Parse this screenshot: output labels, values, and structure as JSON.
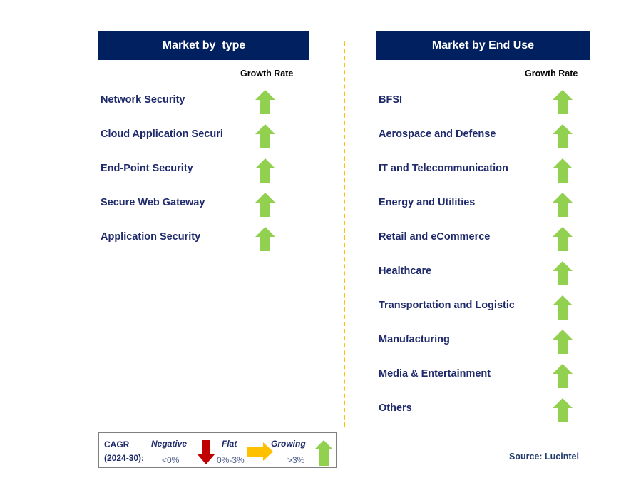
{
  "left_panel": {
    "title": "Market by  type",
    "growth_label": "Growth Rate",
    "items": [
      {
        "label": "Network Security",
        "trend": "growing"
      },
      {
        "label": "Cloud Application Securi",
        "trend": "growing"
      },
      {
        "label": "End-Point Security",
        "trend": "growing"
      },
      {
        "label": "Secure Web Gateway",
        "trend": "growing"
      },
      {
        "label": "Application Security",
        "trend": "growing"
      }
    ]
  },
  "right_panel": {
    "title": "Market by End Use",
    "growth_label": "Growth Rate",
    "items": [
      {
        "label": "BFSI",
        "trend": "growing"
      },
      {
        "label": "Aerospace and Defense",
        "trend": "growing"
      },
      {
        "label": "IT and Telecommunication",
        "trend": "growing"
      },
      {
        "label": "Energy and Utilities",
        "trend": "growing"
      },
      {
        "label": "Retail and eCommerce",
        "trend": "growing"
      },
      {
        "label": "Healthcare",
        "trend": "growing"
      },
      {
        "label": "Transportation and Logistic",
        "trend": "growing"
      },
      {
        "label": "Manufacturing",
        "trend": "growing"
      },
      {
        "label": "Media & Entertainment",
        "trend": "growing"
      },
      {
        "label": "Others",
        "trend": "growing"
      }
    ]
  },
  "legend": {
    "cagr_label": "CAGR",
    "period_label": "(2024-30):",
    "negative_label": "Negative",
    "negative_range": "<0%",
    "flat_label": "Flat",
    "flat_range": "0%-3%",
    "growing_label": "Growing",
    "growing_range": ">3%"
  },
  "source": "Source: Lucintel",
  "colors": {
    "header_bg": "#002060",
    "growing": "#92d050",
    "negative": "#c00000",
    "flat": "#ffc000",
    "divider": "#ffc000"
  }
}
